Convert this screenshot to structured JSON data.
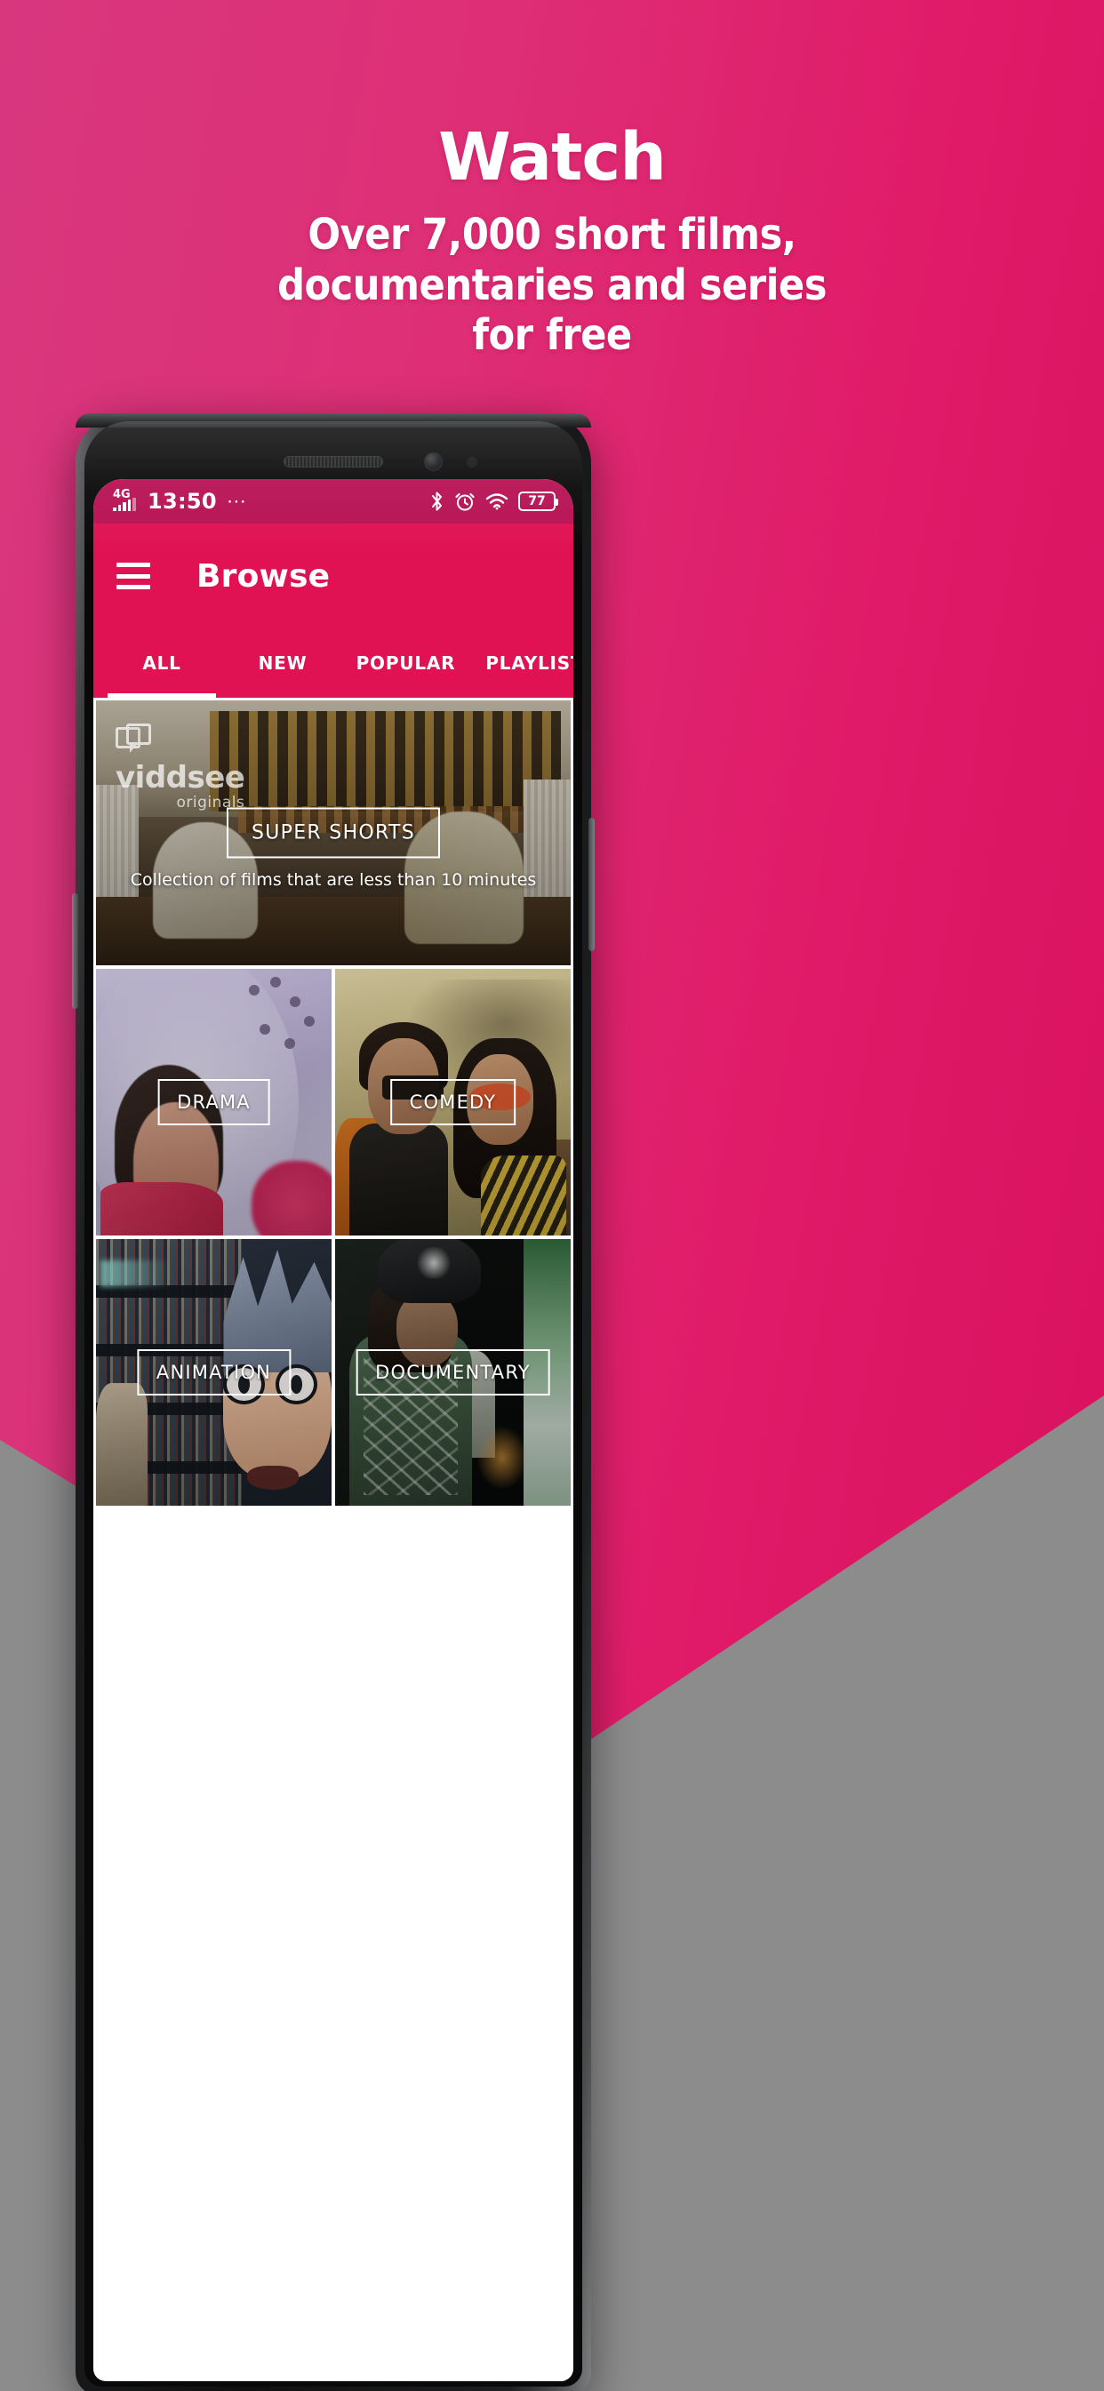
{
  "promo": {
    "title": "Watch",
    "subtitle_lines": [
      "Over 7,000 short films,",
      "documentaries and series",
      "for free"
    ]
  },
  "theme": {
    "pink": "#e01254",
    "pink_dark": "#b81254",
    "background_gray": "#8c8c8c",
    "accent_white": "#ffffff"
  },
  "phone": {
    "status_bar": {
      "network": "4G",
      "time": "13:50",
      "overflow_dots": "⋯",
      "bluetooth_icon": "bluetooth-icon",
      "alarm_icon": "alarm-icon",
      "wifi_icon": "wifi-icon",
      "battery_level": "77"
    },
    "app_bar": {
      "menu_icon": "hamburger-menu-icon",
      "title": "Browse"
    },
    "tabs": [
      {
        "label": "ALL",
        "active": true
      },
      {
        "label": "NEW",
        "active": false
      },
      {
        "label": "POPULAR",
        "active": false
      },
      {
        "label": "PLAYLISTS",
        "active": false
      }
    ],
    "featured": {
      "watermark_word": "viddsee",
      "watermark_sub": "originals",
      "label": "SUPER SHORTS",
      "description": "Collection of films that are less than 10 minutes"
    },
    "categories": [
      {
        "label": "DRAMA"
      },
      {
        "label": "COMEDY"
      },
      {
        "label": "ANIMATION"
      },
      {
        "label": "DOCUMENTARY"
      }
    ]
  }
}
